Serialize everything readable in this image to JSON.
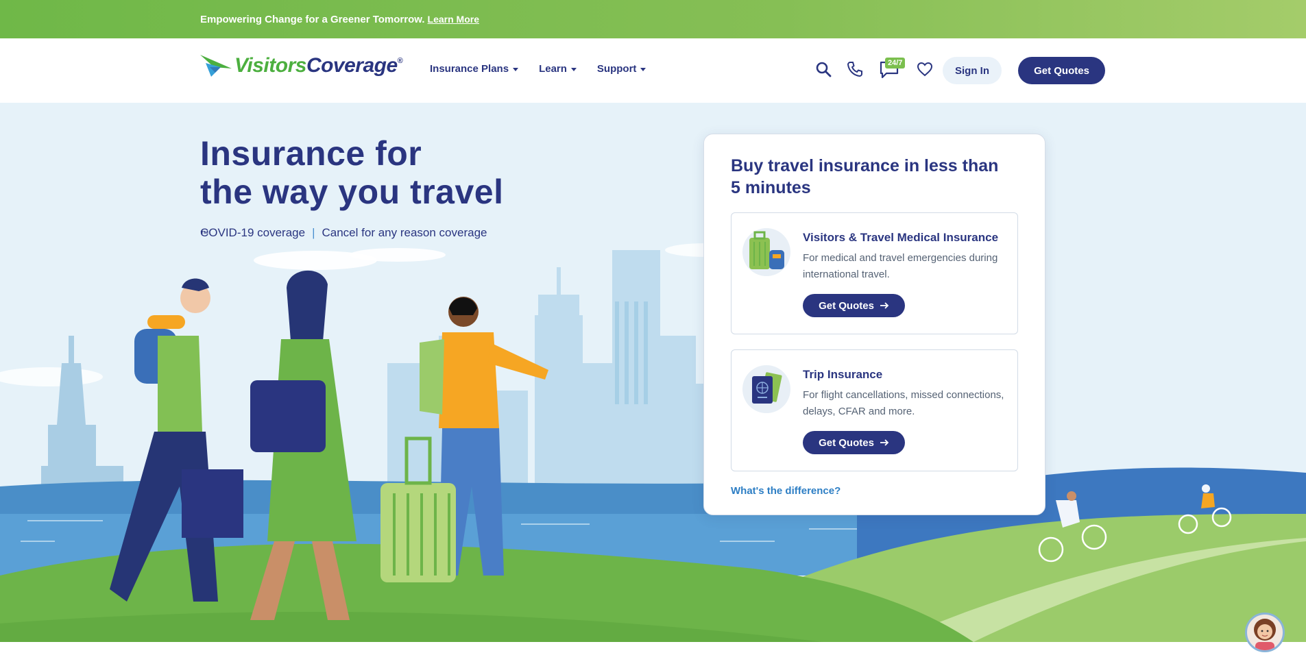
{
  "banner": {
    "text": "Empowering Change for a Greener Tomorrow.",
    "link": "Learn More"
  },
  "header": {
    "logo": {
      "part1": "Visitors",
      "part2": "Coverage",
      "reg": "®"
    },
    "nav": [
      "Insurance Plans",
      "Learn",
      "Support"
    ],
    "chat_badge": "24/7",
    "signin": "Sign In",
    "get_quotes": "Get Quotes"
  },
  "hero": {
    "title_line1": "Insurance for",
    "title_line2": "the way you travel",
    "trademark": "™",
    "sub1": "COVID-19 coverage",
    "separator": "|",
    "sub2": "Cancel for any reason coverage"
  },
  "card": {
    "title": "Buy travel insurance in less than 5 minutes",
    "products": [
      {
        "name": "Visitors & Travel Medical Insurance",
        "desc": "For medical and travel emergencies during international travel.",
        "button": "Get Quotes"
      },
      {
        "name": "Trip Insurance",
        "desc": "For flight cancellations, missed connections, delays, CFAR and more.",
        "button": "Get Quotes"
      }
    ],
    "diff_link": "What's the difference?"
  },
  "colors": {
    "brand_navy": "#2a3580",
    "brand_green": "#6fb848",
    "link_blue": "#2d7ec4",
    "hero_bg": "#e6f2f9"
  },
  "icons": [
    "search-icon",
    "phone-icon",
    "chat-icon",
    "heart-icon",
    "arrow-right-icon",
    "caret-down-icon"
  ]
}
